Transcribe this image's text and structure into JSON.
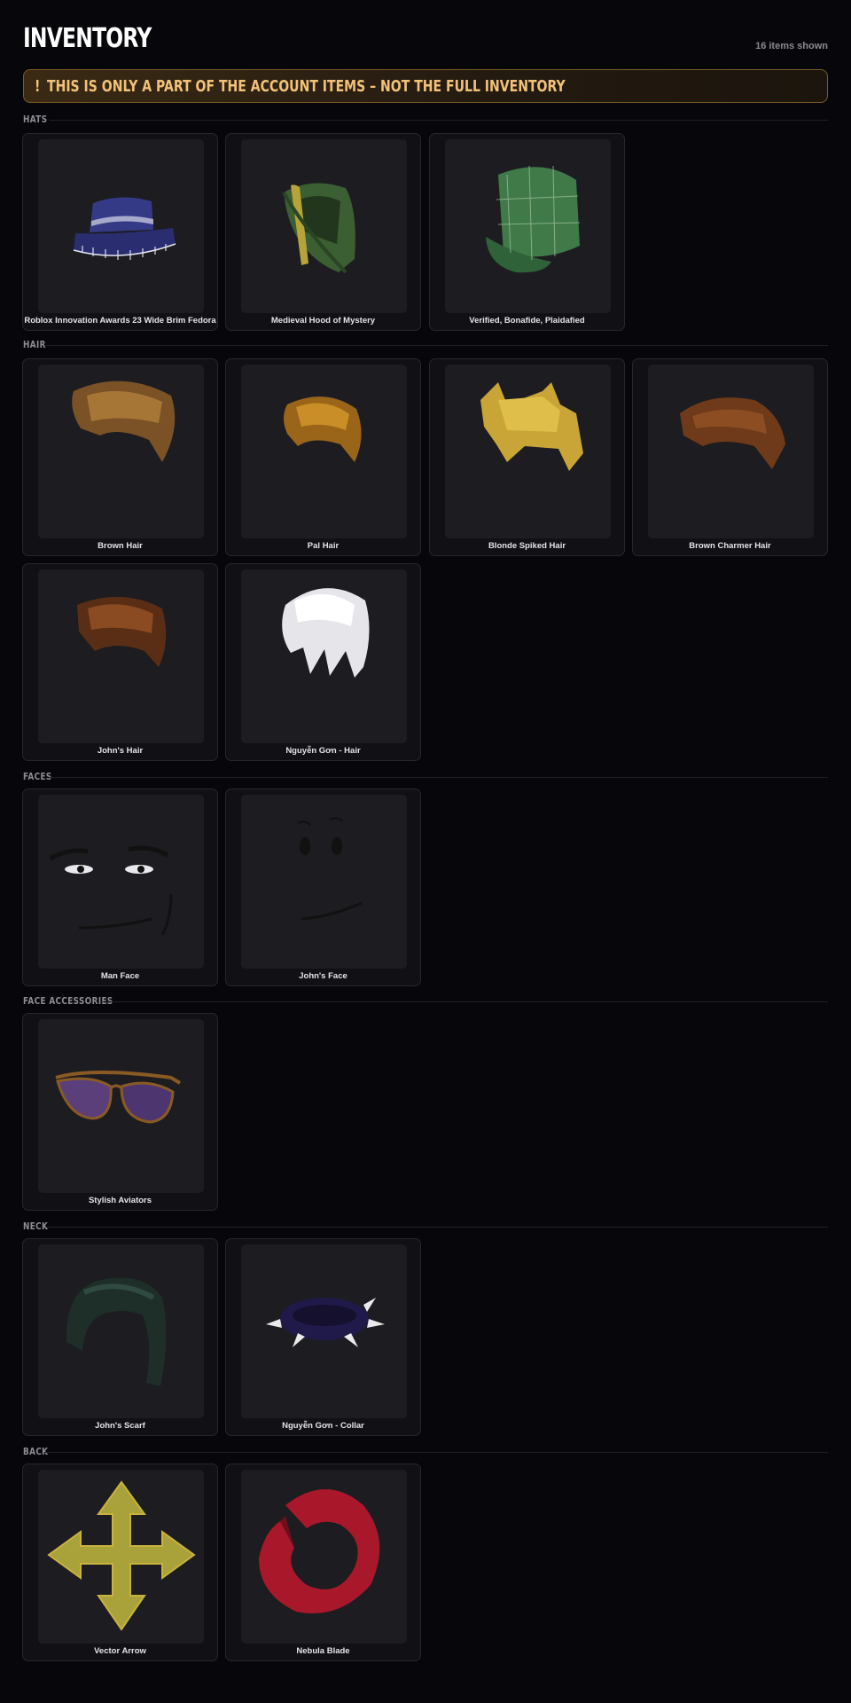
{
  "header": {
    "title": "INVENTORY",
    "count": "16 items shown"
  },
  "warning": {
    "icon": "!",
    "text": "THIS IS ONLY A PART OF THE ACCOUNT ITEMS – NOT THE FULL INVENTORY"
  },
  "categories": [
    {
      "label": "HATS",
      "items": [
        {
          "name": "Roblox Innovation Awards 23 Wide Brim Fedora",
          "icon": "fedora-icon"
        },
        {
          "name": "Medieval Hood of Mystery",
          "icon": "hood-icon"
        },
        {
          "name": "Verified, Bonafide, Plaidafied",
          "icon": "plaid-cap-icon"
        }
      ]
    },
    {
      "label": "HAIR",
      "items": [
        {
          "name": "Brown Hair",
          "icon": "hair-icon"
        },
        {
          "name": "Pal Hair",
          "icon": "hair-icon"
        },
        {
          "name": "Blonde Spiked Hair",
          "icon": "spiked-hair-icon"
        },
        {
          "name": "Brown Charmer Hair",
          "icon": "hair-icon"
        },
        {
          "name": "John's Hair",
          "icon": "hair-icon"
        },
        {
          "name": "Nguyễn Gơn - Hair",
          "icon": "white-hair-icon"
        }
      ]
    },
    {
      "label": "FACES",
      "items": [
        {
          "name": "Man Face",
          "icon": "man-face-icon"
        },
        {
          "name": "John's Face",
          "icon": "smile-face-icon"
        }
      ]
    },
    {
      "label": "FACE ACCESSORIES",
      "items": [
        {
          "name": "Stylish Aviators",
          "icon": "aviators-icon"
        }
      ]
    },
    {
      "label": "NECK",
      "items": [
        {
          "name": "John's Scarf",
          "icon": "scarf-icon"
        },
        {
          "name": "Nguyễn Gơn - Collar",
          "icon": "spiked-collar-icon"
        }
      ]
    },
    {
      "label": "BACK",
      "items": [
        {
          "name": "Vector Arrow",
          "icon": "arrow-cross-icon"
        },
        {
          "name": "Nebula Blade",
          "icon": "crescent-blade-icon"
        }
      ]
    }
  ]
}
